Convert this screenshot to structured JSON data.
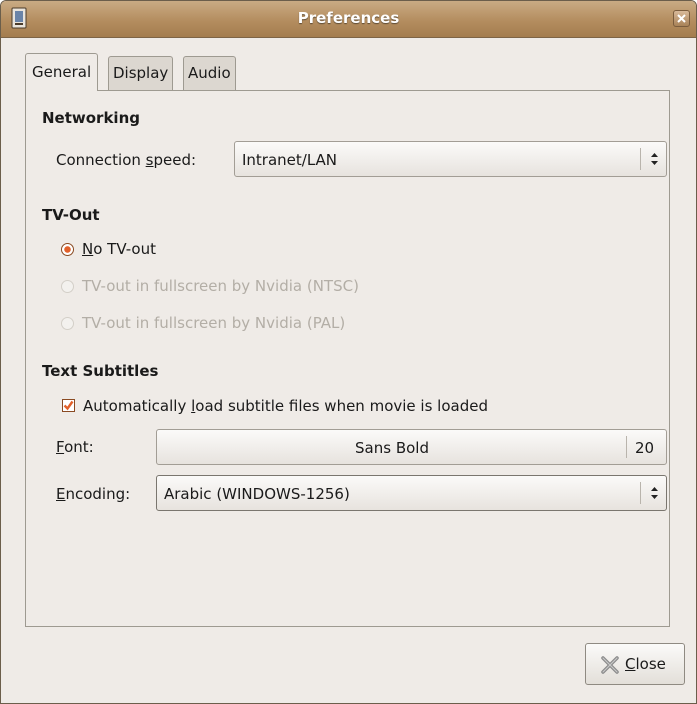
{
  "window": {
    "title": "Preferences"
  },
  "tabs": [
    {
      "label": "General"
    },
    {
      "label": "Display"
    },
    {
      "label": "Audio"
    }
  ],
  "networking": {
    "heading": "Networking",
    "connection_label_pre": "Connection ",
    "connection_label_mnemonic": "s",
    "connection_label_post": "peed:",
    "connection_value": "Intranet/LAN"
  },
  "tvout": {
    "heading": "TV-Out",
    "options": [
      {
        "mnemonic": "N",
        "rest": "o TV-out",
        "selected": true,
        "enabled": true
      },
      {
        "label": "TV-out in fullscreen by Nvidia (NTSC)",
        "selected": false,
        "enabled": false
      },
      {
        "label": "TV-out in fullscreen by Nvidia (PAL)",
        "selected": false,
        "enabled": false
      }
    ]
  },
  "subtitles": {
    "heading": "Text Subtitles",
    "autoload_pre": "Automatically ",
    "autoload_mnemonic": "l",
    "autoload_post": "oad subtitle files when movie is loaded",
    "autoload_checked": true,
    "font_label_mnemonic": "F",
    "font_label_rest": "ont:",
    "font_name": "Sans Bold",
    "font_size": "20",
    "encoding_label_mnemonic": "E",
    "encoding_label_rest": "ncoding:",
    "encoding_value": "Arabic (WINDOWS-1256)"
  },
  "buttons": {
    "close_mnemonic": "C",
    "close_rest": "lose"
  },
  "colors": {
    "titlebar": "#b48d5f",
    "accent": "#e2602a",
    "background": "#efebe7"
  }
}
